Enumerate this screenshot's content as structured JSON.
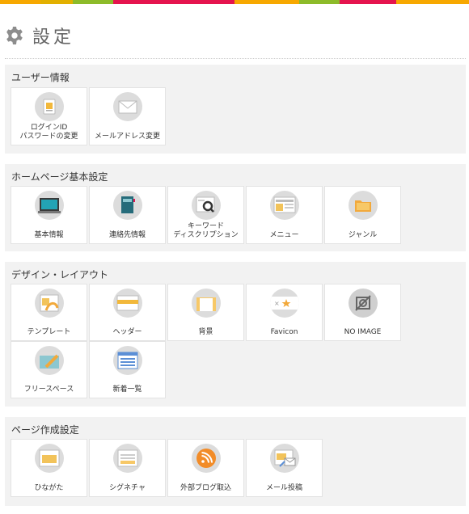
{
  "page": {
    "title": "設定"
  },
  "topbar": {
    "colors": [
      "#f7a800",
      "#e2b000",
      "#8dbb2a",
      "#e5144e",
      "#e5144e",
      "#f7a800",
      "#8dbb2a",
      "#e5144e",
      "#f7a800"
    ]
  },
  "sections": [
    {
      "title": "ユーザー情報",
      "items": [
        {
          "label": "ログインID\nパスワードの変更",
          "icon": "login-id-icon"
        },
        {
          "label": "メールアドレス変更",
          "icon": "mail-icon"
        }
      ]
    },
    {
      "title": "ホームページ基本設定",
      "items": [
        {
          "label": "基本情報",
          "icon": "monitor-icon"
        },
        {
          "label": "連絡先情報",
          "icon": "notebook-icon"
        },
        {
          "label": "キーワード\nディスクリプション",
          "icon": "keyword-search-icon"
        },
        {
          "label": "メニュー",
          "icon": "menu-icon"
        },
        {
          "label": "ジャンル",
          "icon": "folder-icon"
        }
      ]
    },
    {
      "title": "デザイン・レイアウト",
      "items": [
        {
          "label": "テンプレート",
          "icon": "template-icon"
        },
        {
          "label": "ヘッダー",
          "icon": "header-icon"
        },
        {
          "label": "背景",
          "icon": "background-icon"
        },
        {
          "label": "Favicon",
          "icon": "favicon-icon"
        },
        {
          "label": "NO IMAGE",
          "icon": "no-image-icon"
        },
        {
          "label": "フリースペース",
          "icon": "free-space-icon"
        },
        {
          "label": "新着一覧",
          "icon": "news-list-icon"
        }
      ]
    },
    {
      "title": "ページ作成設定",
      "items": [
        {
          "label": "ひながた",
          "icon": "page-template-icon"
        },
        {
          "label": "シグネチャ",
          "icon": "signature-icon"
        },
        {
          "label": "外部ブログ取込",
          "icon": "rss-icon"
        },
        {
          "label": "メール投稿",
          "icon": "mail-post-icon"
        }
      ]
    }
  ]
}
